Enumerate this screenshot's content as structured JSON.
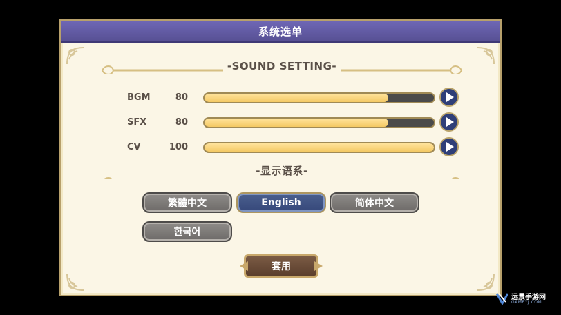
{
  "dialog": {
    "title": "系统选单"
  },
  "sound": {
    "header": "-SOUND SETTING-",
    "rows": [
      {
        "name": "BGM",
        "value": "80",
        "level": 0.8
      },
      {
        "name": "SFX",
        "value": "80",
        "level": 0.8
      },
      {
        "name": "CV",
        "value": "100",
        "level": 1.0
      }
    ]
  },
  "language": {
    "header": "-显示语系-",
    "options": [
      {
        "label": "繁體中文",
        "selected": false
      },
      {
        "label": "English",
        "selected": true
      },
      {
        "label": "简体中文",
        "selected": false
      },
      {
        "label": "한국어",
        "selected": false
      }
    ]
  },
  "apply_label": "套用",
  "watermark": {
    "text": "远景手游网",
    "sub": "GAMEYJ.COM"
  },
  "colors": {
    "title_bar": "#575093",
    "panel_bg": "#fbf6e6",
    "slider_fill": "#f4c964",
    "slider_track": "#4a4a4a",
    "button_gray": "#6d6a68",
    "button_selected": "#36487a",
    "apply_brown": "#5b3f2d",
    "gold_trim": "#c8a86b"
  }
}
